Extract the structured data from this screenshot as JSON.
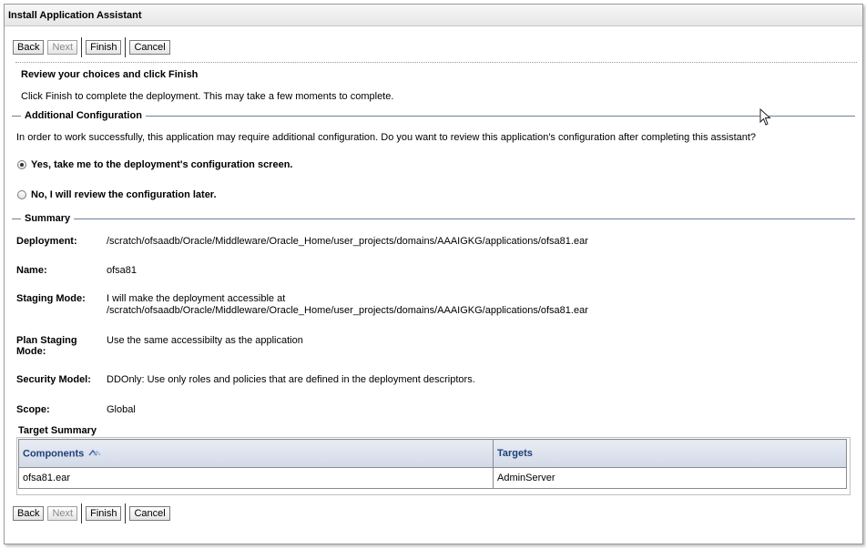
{
  "window": {
    "title": "Install Application Assistant"
  },
  "buttons": {
    "back": "Back",
    "next": "Next",
    "finish": "Finish",
    "cancel": "Cancel"
  },
  "intro": {
    "heading": "Review your choices and click Finish",
    "description": "Click Finish to complete the deployment. This may take a few moments to complete."
  },
  "additional_config": {
    "title": "Additional Configuration",
    "question": "In order to work successfully, this application may require additional configuration. Do you want to review this application's configuration after completing this assistant?",
    "options": [
      {
        "label": "Yes, take me to the deployment's configuration screen.",
        "selected": true
      },
      {
        "label": "No, I will review the configuration later.",
        "selected": false
      }
    ]
  },
  "summary": {
    "title": "Summary",
    "deployment_label": "Deployment:",
    "deployment_value": "/scratch/ofsaadb/Oracle/Middleware/Oracle_Home/user_projects/domains/AAAIGKG/applications/ofsa81.ear",
    "name_label": "Name:",
    "name_value": "ofsa81",
    "staging_label": "Staging Mode:",
    "staging_value_line1": "I will make the deployment accessible at",
    "staging_value_line2": "/scratch/ofsaadb/Oracle/Middleware/Oracle_Home/user_projects/domains/AAAIGKG/applications/ofsa81.ear",
    "plan_staging_label": "Plan Staging Mode:",
    "plan_staging_value": "Use the same accessibilty as the application",
    "security_label": "Security Model:",
    "security_value": "DDOnly: Use only roles and policies that are defined in the deployment descriptors.",
    "scope_label": "Scope:",
    "scope_value": "Global"
  },
  "target_summary": {
    "title": "Target Summary",
    "columns": [
      "Components",
      "Targets"
    ],
    "rows": [
      {
        "component": "ofsa81.ear",
        "target": "AdminServer"
      }
    ]
  },
  "icons": {
    "sort": "sort-ascending-icon",
    "cursor": "mouse-pointer-icon"
  },
  "colors": {
    "section_line": "#6d7f9c",
    "header_text": "#1f3f7a",
    "header_bg": "#d2d9e7"
  }
}
